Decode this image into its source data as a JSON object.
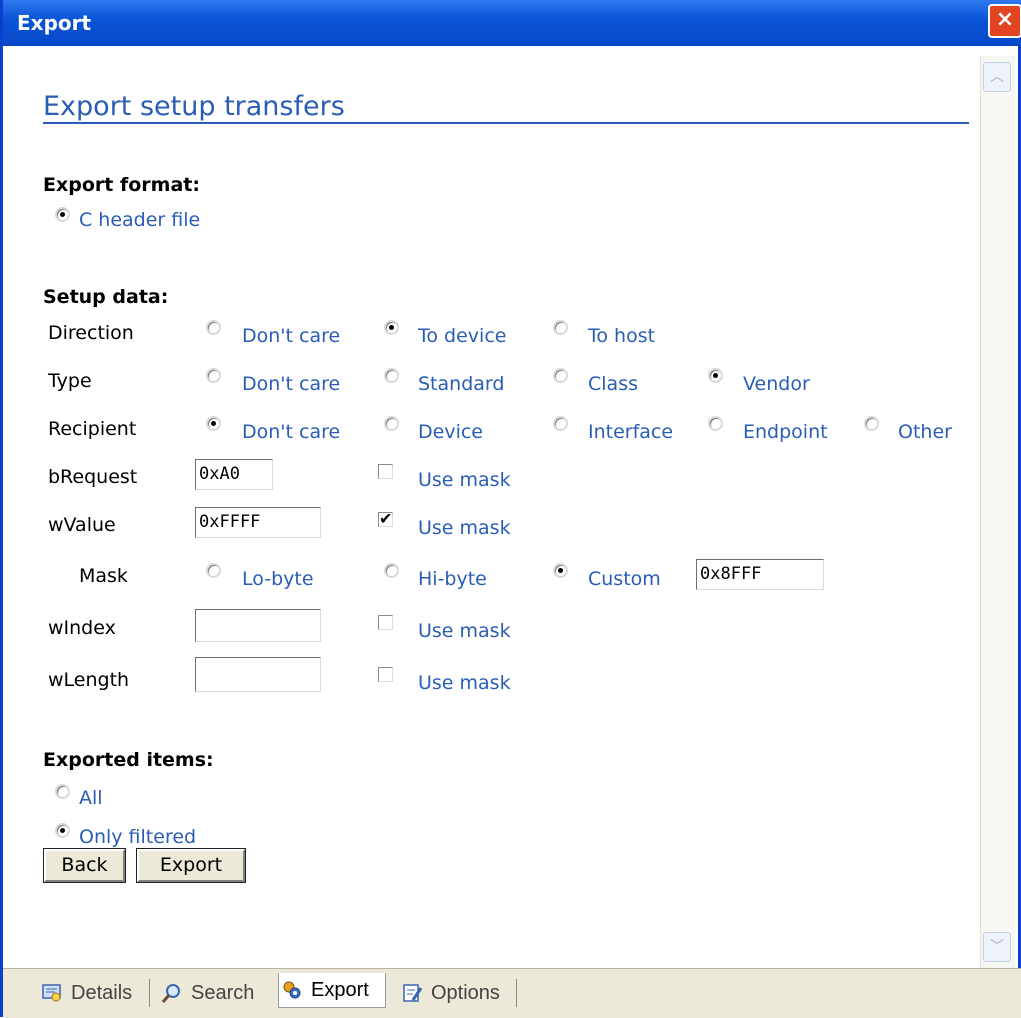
{
  "window": {
    "title": "Export",
    "close_symbol": "×"
  },
  "page": {
    "heading": "Export setup transfers"
  },
  "export_format": {
    "label": "Export format:",
    "options": [
      {
        "label": "C header file",
        "selected": true
      }
    ]
  },
  "setup_data": {
    "label": "Setup data:",
    "direction": {
      "label": "Direction",
      "options": [
        {
          "label": "Don't care",
          "selected": false
        },
        {
          "label": "To device",
          "selected": true
        },
        {
          "label": "To host",
          "selected": false
        }
      ]
    },
    "type": {
      "label": "Type",
      "options": [
        {
          "label": "Don't care",
          "selected": false
        },
        {
          "label": "Standard",
          "selected": false
        },
        {
          "label": "Class",
          "selected": false
        },
        {
          "label": "Vendor",
          "selected": true
        }
      ]
    },
    "recipient": {
      "label": "Recipient",
      "options": [
        {
          "label": "Don't care",
          "selected": true
        },
        {
          "label": "Device",
          "selected": false
        },
        {
          "label": "Interface",
          "selected": false
        },
        {
          "label": "Endpoint",
          "selected": false
        },
        {
          "label": "Other",
          "selected": false
        }
      ]
    },
    "brequest": {
      "label": "bRequest",
      "value": "0xA0",
      "use_mask_label": "Use mask",
      "use_mask": false
    },
    "wvalue": {
      "label": "wValue",
      "value": "0xFFFF",
      "use_mask_label": "Use mask",
      "use_mask": true
    },
    "mask": {
      "label": "Mask",
      "options": [
        {
          "label": "Lo-byte",
          "selected": false
        },
        {
          "label": "Hi-byte",
          "selected": false
        },
        {
          "label": "Custom",
          "selected": true
        }
      ],
      "custom_value": "0x8FFF"
    },
    "windex": {
      "label": "wIndex",
      "value": "",
      "use_mask_label": "Use mask",
      "use_mask": false
    },
    "wlength": {
      "label": "wLength",
      "value": "",
      "use_mask_label": "Use mask",
      "use_mask": false
    }
  },
  "exported_items": {
    "label": "Exported items:",
    "options": [
      {
        "label": "All",
        "selected": false
      },
      {
        "label": "Only filtered",
        "selected": true
      }
    ]
  },
  "buttons": {
    "back": "Back",
    "export": "Export"
  },
  "tabs": [
    {
      "label": "Details",
      "icon": "details-icon",
      "active": false
    },
    {
      "label": "Search",
      "icon": "search-icon",
      "active": false
    },
    {
      "label": "Export",
      "icon": "export-icon",
      "active": true
    },
    {
      "label": "Options",
      "icon": "options-icon",
      "active": false
    }
  ],
  "colors": {
    "link": "#2a5db5",
    "titlebar": "#0b55d8",
    "close": "#e14420"
  }
}
